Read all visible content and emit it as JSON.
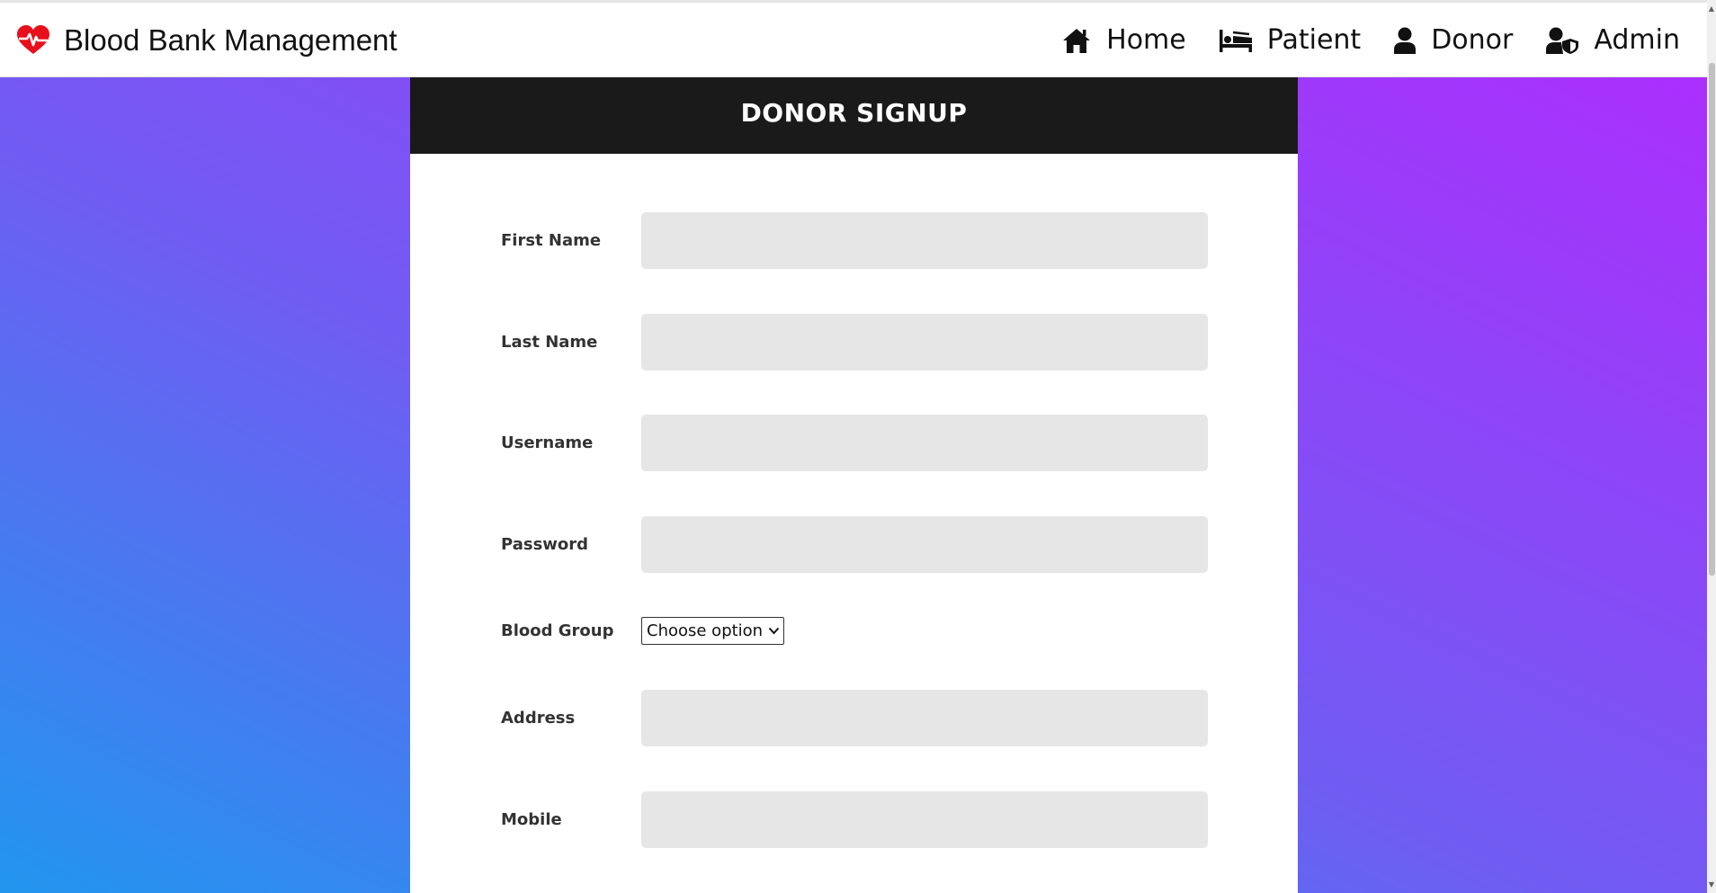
{
  "navbar": {
    "brand": "Blood Bank Management",
    "items": [
      {
        "label": "Home",
        "icon": "home-icon"
      },
      {
        "label": "Patient",
        "icon": "bed-icon"
      },
      {
        "label": "Donor",
        "icon": "user-icon"
      },
      {
        "label": "Admin",
        "icon": "user-shield-icon"
      }
    ]
  },
  "form": {
    "title": "DONOR SIGNUP",
    "fields": {
      "first_name": {
        "label": "First Name",
        "value": ""
      },
      "last_name": {
        "label": "Last Name",
        "value": ""
      },
      "username": {
        "label": "Username",
        "value": ""
      },
      "password": {
        "label": "Password",
        "value": ""
      },
      "blood_group": {
        "label": "Blood Group",
        "selected": "Choose option"
      },
      "address": {
        "label": "Address",
        "value": ""
      },
      "mobile": {
        "label": "Mobile",
        "value": ""
      }
    }
  },
  "colors": {
    "brand_icon": "#e8101c",
    "header_bg": "#1a1a1a",
    "gradient_start": "#2196ef",
    "gradient_end": "#ab2ffd",
    "input_bg": "#e6e6e6"
  }
}
